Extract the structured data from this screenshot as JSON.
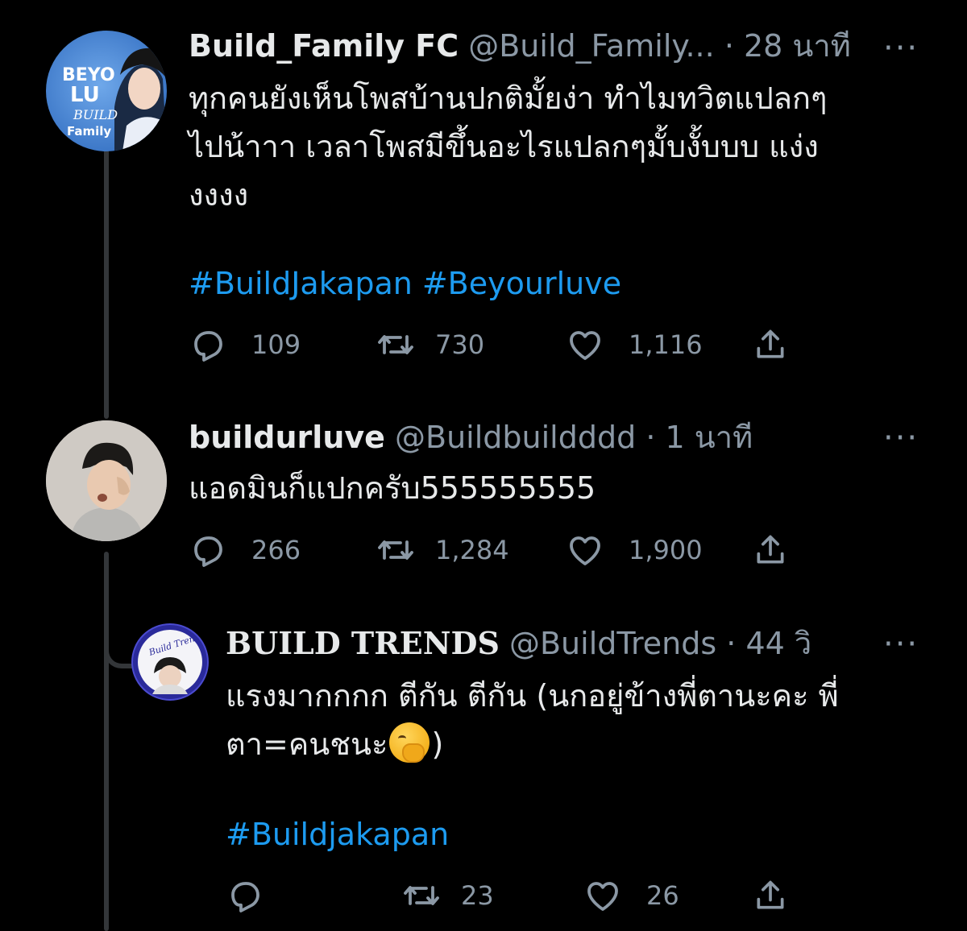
{
  "tweets": [
    {
      "name": "Build_Family FC",
      "handle": "@Build_Family...",
      "separator": "·",
      "time": "28 นาที",
      "more": "···",
      "text": "ทุกคนยังเห็นโพสบ้านปกติมั้ยง่า ทำไมทวิตแปลกๆ\nไปน้าาา เวลาโพสมีขึ้นอะไรแปลกๆมั้บงั้บบบ แง่ง\nงงงง",
      "hashtags": [
        "#BuildJakapan",
        "#Beyourluve"
      ],
      "avatar_text": [
        "BEYO",
        "LU",
        "BUILD",
        "Family"
      ],
      "replies": "109",
      "retweets": "730",
      "likes": "1,116"
    },
    {
      "name": "buildurluve",
      "handle": "@Buildbuildddd",
      "separator": "·",
      "time": "1 นาที",
      "more": "···",
      "text": "แอดมินก็แปกครับ555555555",
      "replies": "266",
      "retweets": "1,284",
      "likes": "1,900"
    },
    {
      "name": "BUILD TRENDS",
      "handle": "@BuildTrends",
      "separator": "·",
      "time": "44 วิ",
      "more": "···",
      "text_line1": "แรงมากกกก ตีกัน ตีกัน (นกอยู่ข้างพี่ตานะคะ พี่",
      "text_line2_a": "ตา=คนชนะ",
      "text_line2_b": ")",
      "emoji": "face-with-hand-over-mouth",
      "hashtags": [
        "#Buildjakapan"
      ],
      "avatar_text": "Build Trends",
      "replies": "",
      "retweets": "23",
      "likes": "26"
    }
  ],
  "colors": {
    "background": "#000000",
    "text": "#e7e9ea",
    "muted": "#8b98a5",
    "link": "#1d9bf0",
    "thread": "#333639"
  }
}
